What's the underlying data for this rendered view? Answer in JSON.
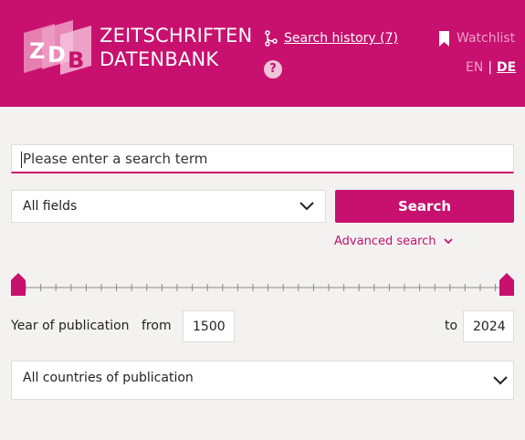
{
  "header": {
    "logo_line1": "ZEITSCHRIFTEN",
    "logo_line2": "DATENBANK",
    "search_history": "Search history (7)",
    "help": "?",
    "watchlist": "Watchlist",
    "lang_en": "EN",
    "lang_sep": "|",
    "lang_de": "DE",
    "colors": {
      "brand": "#c8106e",
      "background": "#f3f2f1"
    }
  },
  "search": {
    "placeholder": "Please enter a search term",
    "field_selected": "All fields",
    "button": "Search",
    "advanced": "Advanced search"
  },
  "year": {
    "label": "Year of publication",
    "from_label": "from",
    "from_value": "1500",
    "to_label": "to",
    "to_value": "2024"
  },
  "country": {
    "selected": "All countries of publication"
  }
}
